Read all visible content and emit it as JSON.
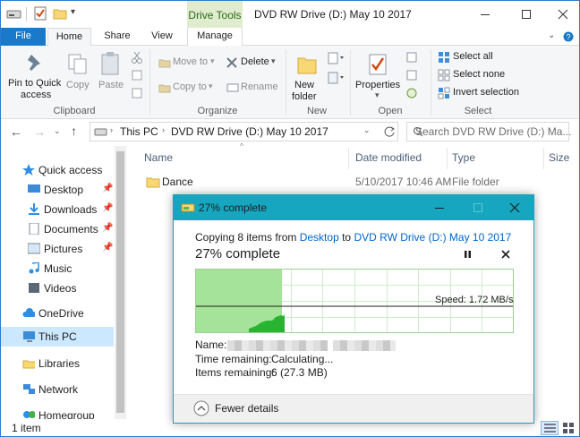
{
  "window": {
    "title": "DVD RW Drive (D:) May 10 2017",
    "context_tab": "Drive Tools"
  },
  "tabs": [
    "File",
    "Home",
    "Share",
    "View",
    "Manage"
  ],
  "ribbon": {
    "clipboard": {
      "pin_label_1": "Pin to Quick",
      "pin_label_2": "access",
      "copy": "Copy",
      "paste": "Paste",
      "group": "Clipboard"
    },
    "organize": {
      "move_to": "Move to",
      "copy_to": "Copy to",
      "delete": "Delete",
      "rename": "Rename",
      "group": "Organize"
    },
    "new": {
      "new_folder_1": "New",
      "new_folder_2": "folder",
      "group": "New"
    },
    "open": {
      "properties": "Properties",
      "group": "Open"
    },
    "select": {
      "select_all": "Select all",
      "select_none": "Select none",
      "invert": "Invert selection",
      "group": "Select"
    }
  },
  "address": {
    "crumbs": [
      "This PC",
      "DVD RW Drive (D:) May 10 2017"
    ],
    "search_placeholder": "Search DVD RW Drive (D:) Ma..."
  },
  "nav": {
    "quick_access": "Quick access",
    "items": [
      "Desktop",
      "Downloads",
      "Documents",
      "Pictures",
      "Music",
      "Videos"
    ],
    "onedrive": "OneDrive",
    "this_pc": "This PC",
    "libraries": "Libraries",
    "network": "Network",
    "homegroup": "Homegroup"
  },
  "columns": {
    "name": "Name",
    "date": "Date modified",
    "type": "Type",
    "size": "Size"
  },
  "files": [
    {
      "name": "Dance",
      "date": "5/10/2017 10:46 AM",
      "type": "File folder"
    }
  ],
  "status": {
    "count": "1 item"
  },
  "dialog": {
    "title": "27% complete",
    "copying_prefix": "Copying 8 items from",
    "from": "Desktop",
    "to_word": "to",
    "to": "DVD RW Drive (D:) May 10 2017",
    "percent_text": "27% complete",
    "progress": 0.27,
    "speed": "Speed: 1.72 MB/s",
    "name_label": "Name:",
    "time_label": "Time remaining:",
    "time_value": "Calculating...",
    "items_label": "Items remaining:",
    "items_value": "6 (27.3 MB)",
    "fewer": "Fewer details"
  },
  "colors": {
    "accent": "#1979ca",
    "dialog_title": "#16a6c0",
    "graph_fill": "#a6e39a",
    "graph_line": "#28b430",
    "context_tab_bg": "#dfeccf"
  }
}
